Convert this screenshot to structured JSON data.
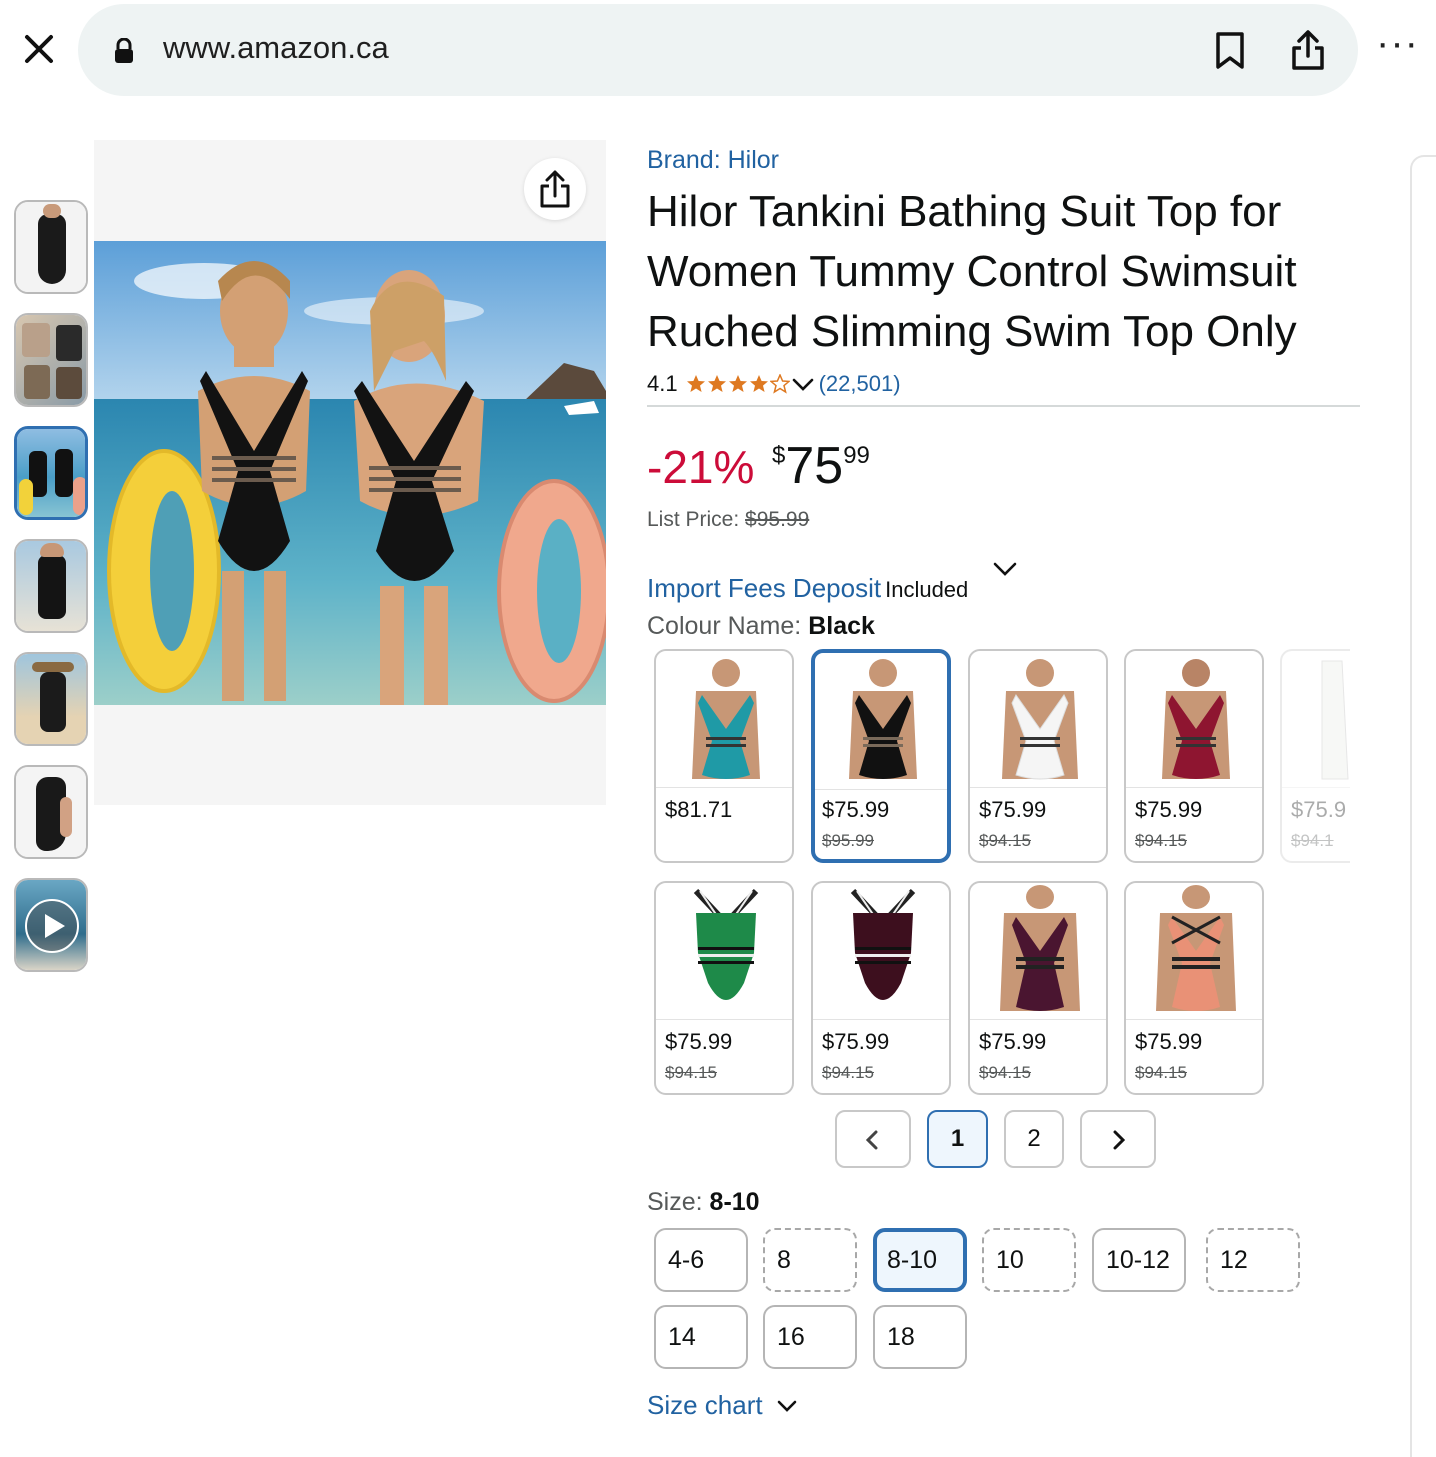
{
  "browser": {
    "url": "www.amazon.ca",
    "more_label": "···"
  },
  "gallery": {
    "thumbnails": [
      "photo-1",
      "photo-2",
      "photo-3",
      "photo-4",
      "photo-5",
      "photo-6",
      "video-7"
    ],
    "selected_index": 2
  },
  "product": {
    "brand": "Brand: Hilor",
    "title": "Hilor Tankini Bathing Suit Top for Women Tummy Control Swimsuit Ruched Slimming Swim Top Only",
    "rating": "4.1",
    "rating_value": 4.1,
    "review_count": "(22,501)",
    "discount": "-21%",
    "price_symbol": "$",
    "price_whole": "75",
    "price_fraction": "99",
    "list_price_label": "List Price:",
    "list_price": "$95.99",
    "import_fees": "Import Fees Deposit",
    "import_included": "Included"
  },
  "colour": {
    "label": "Colour Name:",
    "value": "Black",
    "swatches": [
      {
        "price": "$81.71",
        "was": "",
        "color": "#1f9aa6"
      },
      {
        "price": "$75.99",
        "was": "$95.99",
        "color": "#111111"
      },
      {
        "price": "$75.99",
        "was": "$94.15",
        "color": "#f4f4f4"
      },
      {
        "price": "$75.99",
        "was": "$94.15",
        "color": "#8e1530"
      },
      {
        "price": "$75.9",
        "was": "$94.1",
        "color": "#e9ece8"
      },
      {
        "price": "$75.99",
        "was": "$94.15",
        "color": "#1e8a49"
      },
      {
        "price": "$75.99",
        "was": "$94.15",
        "color": "#3d0f1e"
      },
      {
        "price": "$75.99",
        "was": "$94.15",
        "color": "#4a1530"
      },
      {
        "price": "$75.99",
        "was": "$94.15",
        "color": "#e99176"
      }
    ],
    "selected_index": 1
  },
  "pagination": {
    "prev": "‹",
    "pages": [
      "1",
      "2"
    ],
    "next": "›",
    "current": "1"
  },
  "size": {
    "label": "Size:",
    "value": "8-10",
    "options": [
      "4-6",
      "8",
      "8-10",
      "10",
      "10-12",
      "12",
      "14",
      "16",
      "18"
    ],
    "selected": "8-10",
    "size_chart": "Size chart"
  },
  "colors": {
    "link": "#2162a1",
    "discount": "#cc0c39",
    "star": "#de7921",
    "selected_border": "#2f6fb1"
  }
}
